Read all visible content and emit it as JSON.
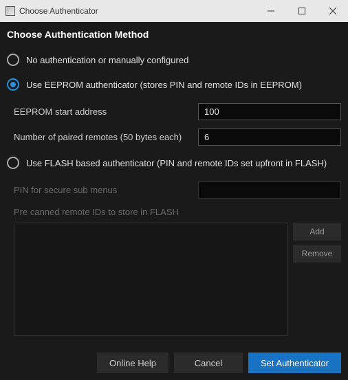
{
  "window": {
    "title": "Choose Authenticator"
  },
  "heading": "Choose Authentication Method",
  "radios": {
    "none": "No authentication or manually configured",
    "eeprom": "Use EEPROM authenticator (stores PIN and remote IDs in EEPROM)",
    "flash": "Use FLASH based authenticator (PIN and remote IDs set upfront in FLASH)"
  },
  "selected_radio": "eeprom",
  "eeprom": {
    "start_address_label": "EEPROM start address",
    "start_address_value": "100",
    "num_remotes_label": "Number of paired remotes (50 bytes each)",
    "num_remotes_value": "6"
  },
  "flash": {
    "pin_label": "PIN for secure sub menus",
    "pin_value": "",
    "list_label": "Pre canned remote IDs to store in FLASH",
    "add_label": "Add",
    "remove_label": "Remove"
  },
  "buttons": {
    "help": "Online Help",
    "cancel": "Cancel",
    "set": "Set Authenticator"
  }
}
